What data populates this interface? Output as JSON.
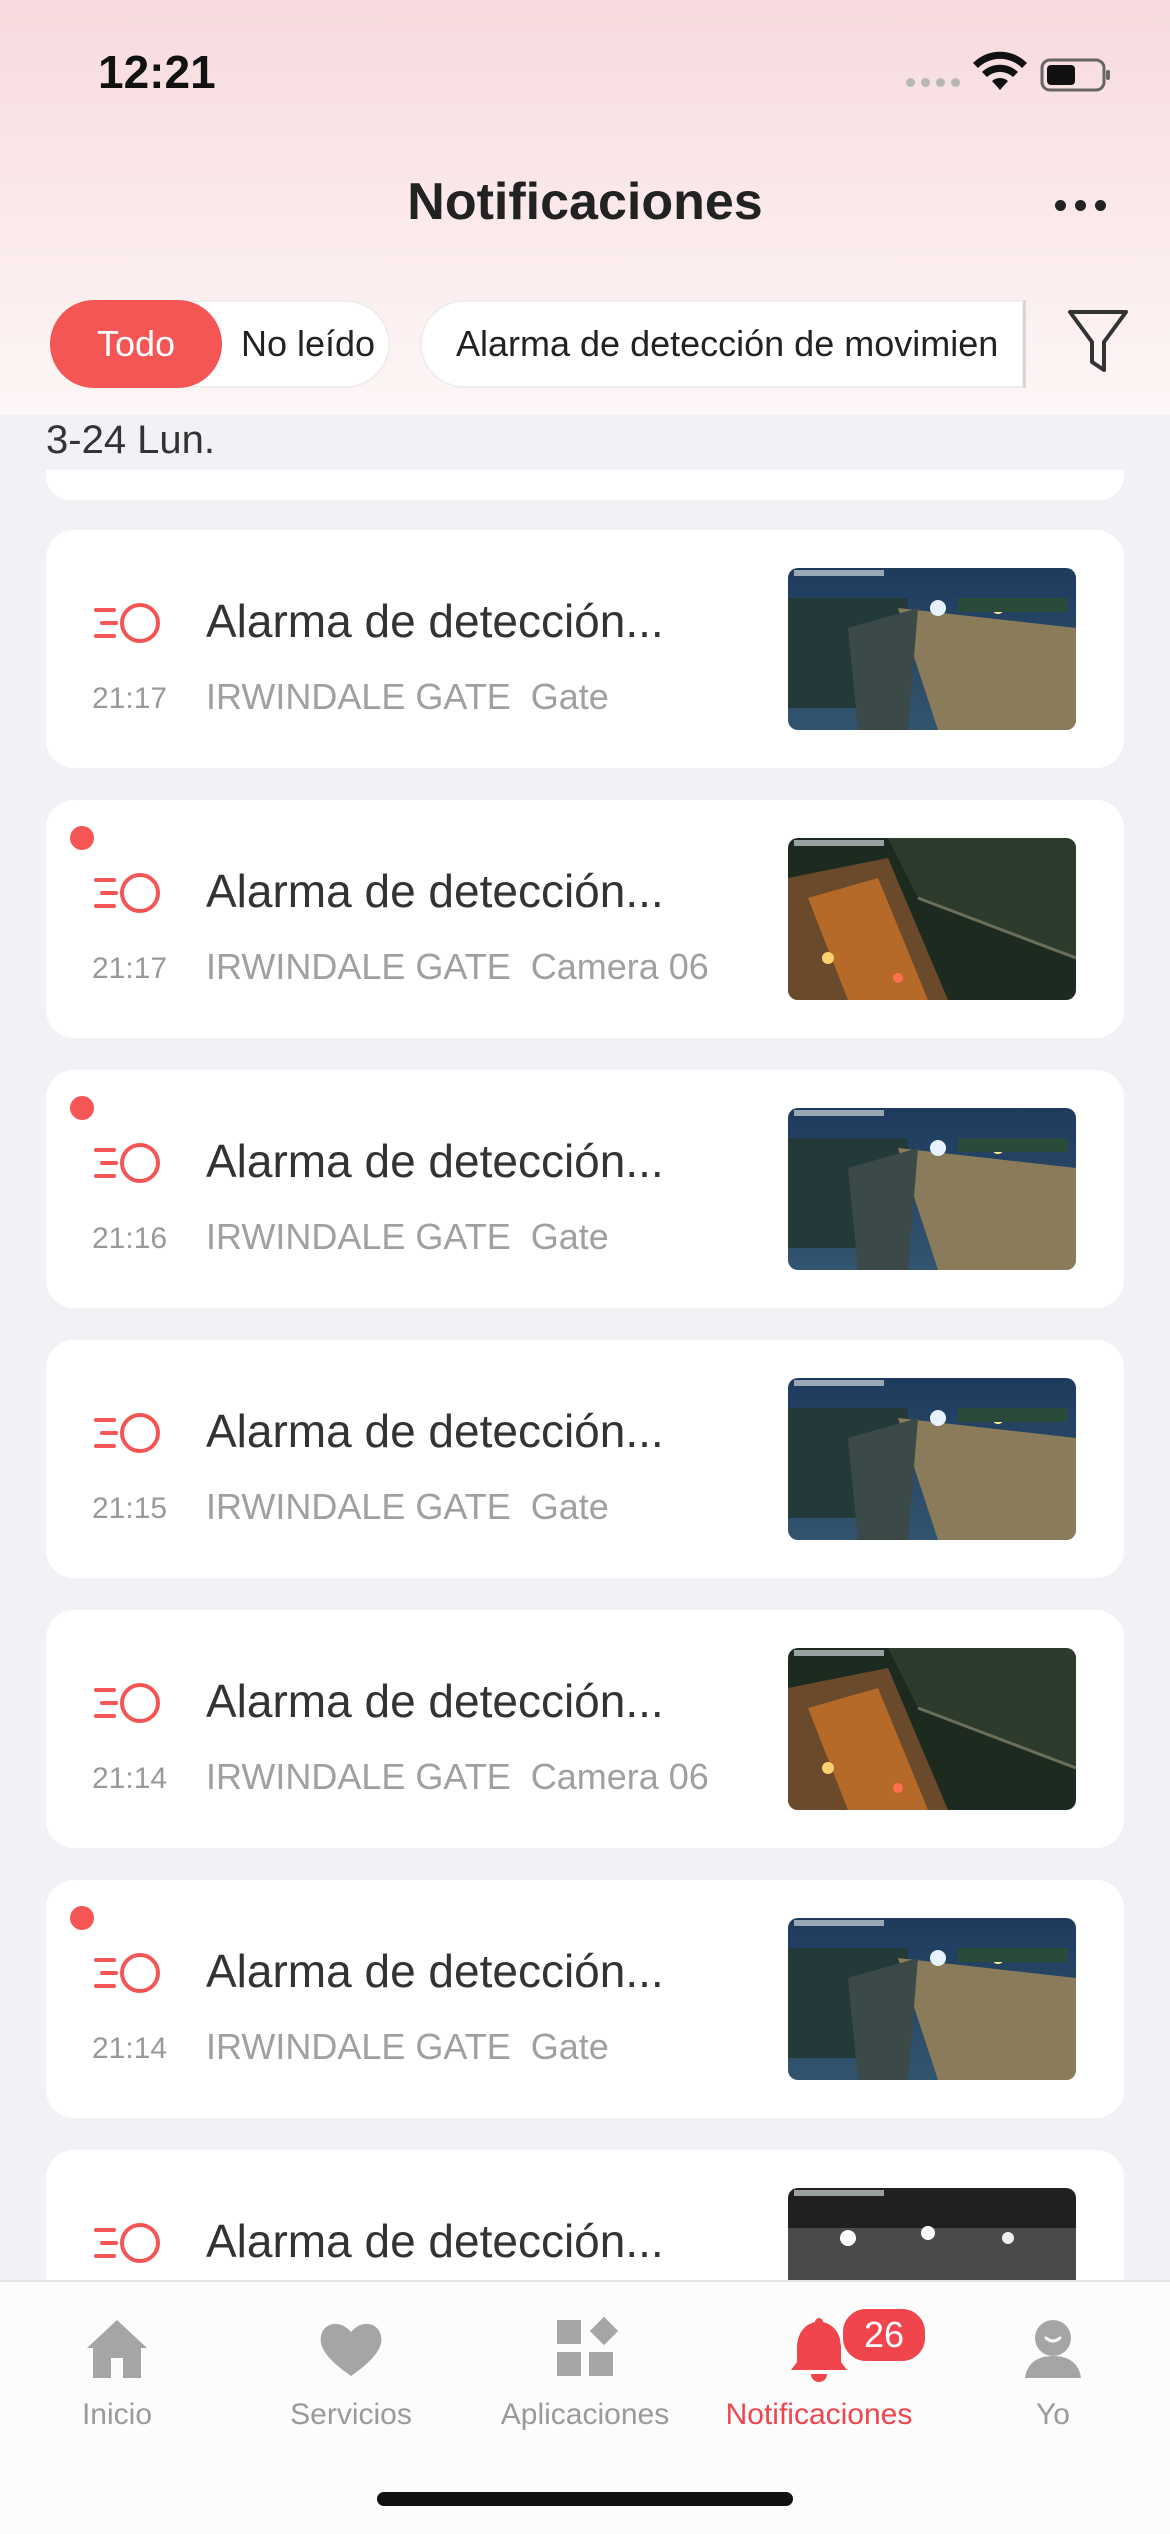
{
  "status_bar": {
    "time": "12:21"
  },
  "header": {
    "title": "Notificaciones"
  },
  "filters": {
    "read_segment": [
      "Todo",
      "No leído"
    ],
    "selected": "Todo",
    "type_filter": "Alarma de detección de movimien"
  },
  "date_group": "3-24 Lun.",
  "notifications": [
    {
      "title": "Alarma de detección...",
      "time": "21:17",
      "site": "IRWINDALE GATE",
      "camera": "Gate",
      "unread": false
    },
    {
      "title": "Alarma de detección...",
      "time": "21:17",
      "site": "IRWINDALE GATE",
      "camera": "Camera 06",
      "unread": true
    },
    {
      "title": "Alarma de detección...",
      "time": "21:16",
      "site": "IRWINDALE GATE",
      "camera": "Gate",
      "unread": true
    },
    {
      "title": "Alarma de detección...",
      "time": "21:15",
      "site": "IRWINDALE GATE",
      "camera": "Gate",
      "unread": false
    },
    {
      "title": "Alarma de detección...",
      "time": "21:14",
      "site": "IRWINDALE GATE",
      "camera": "Camera 06",
      "unread": false
    },
    {
      "title": "Alarma de detección...",
      "time": "21:14",
      "site": "IRWINDALE GATE",
      "camera": "Gate",
      "unread": true
    },
    {
      "title": "Alarma de detección...",
      "time": "",
      "site": "",
      "camera": "",
      "unread": false
    }
  ],
  "tabbar": {
    "items": [
      {
        "label": "Inicio",
        "icon": "home-icon"
      },
      {
        "label": "Servicios",
        "icon": "heart-icon"
      },
      {
        "label": "Aplicaciones",
        "icon": "apps-grid-icon"
      },
      {
        "label": "Notificaciones",
        "icon": "bell-icon",
        "badge": "26"
      },
      {
        "label": "Yo",
        "icon": "person-icon"
      }
    ],
    "active": "Notificaciones"
  },
  "colors": {
    "accent": "#f45555",
    "tab_active": "#f0454c",
    "background": "#f2f1f6"
  }
}
